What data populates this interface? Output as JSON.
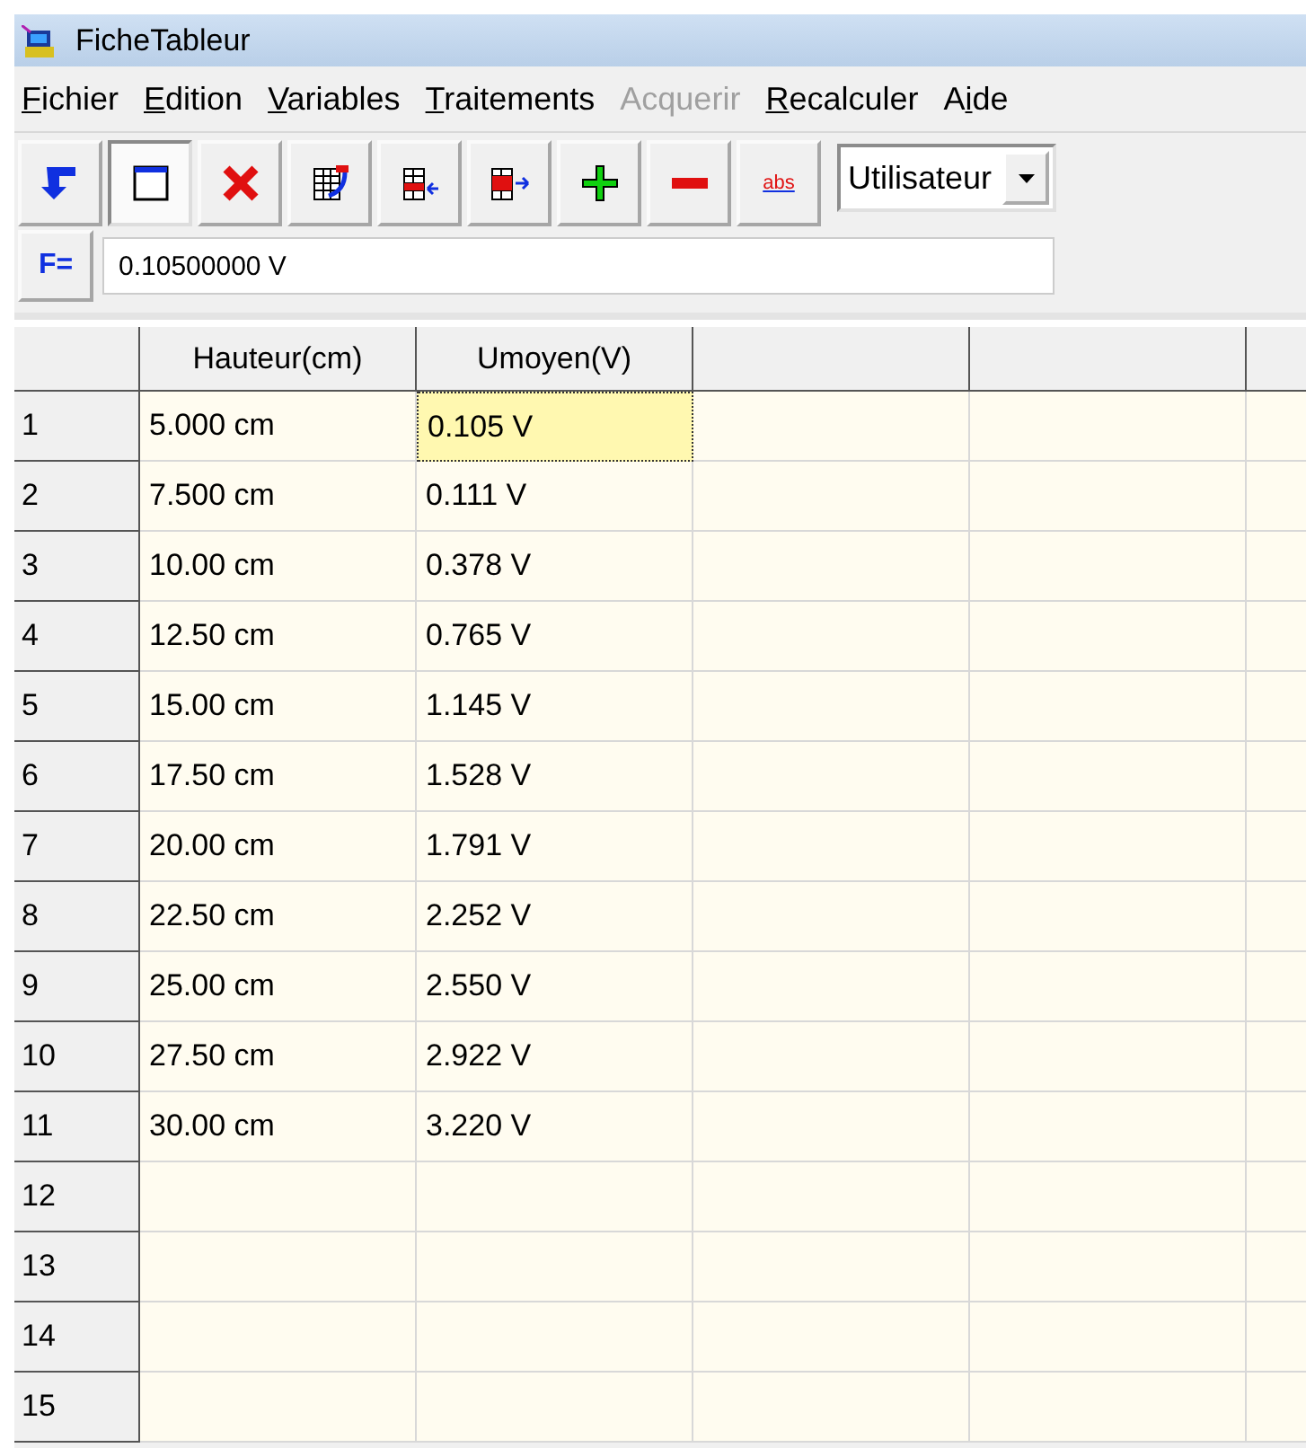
{
  "window": {
    "title": "FicheTableur"
  },
  "menu": [
    {
      "key": "F",
      "post": "ichier",
      "disabled": false
    },
    {
      "key": "E",
      "post": "dition",
      "disabled": false
    },
    {
      "key": "V",
      "post": "ariables",
      "disabled": false
    },
    {
      "key": "T",
      "post": "raitements",
      "disabled": false
    },
    {
      "pre": "Acquerir",
      "disabled": true
    },
    {
      "key": "R",
      "post": "ecalculer",
      "disabled": false
    },
    {
      "pre": "A",
      "key": "i",
      "post": "de",
      "disabled": false
    }
  ],
  "toolbar": [
    {
      "kind": "arrow",
      "selected": false
    },
    {
      "kind": "window",
      "selected": true
    },
    {
      "kind": "delete",
      "selected": false
    },
    {
      "kind": "edit-grid",
      "selected": false
    },
    {
      "kind": "grid-left",
      "selected": false
    },
    {
      "kind": "grid-right",
      "selected": false
    },
    {
      "kind": "plus",
      "selected": false
    },
    {
      "kind": "minus",
      "selected": false
    },
    {
      "kind": "text",
      "label": "abs",
      "selected": false
    }
  ],
  "mode_dropdown": {
    "value": "Utilisateur"
  },
  "formula": {
    "label": "F=",
    "value": "0.10500000 V"
  },
  "table": {
    "columns": [
      "Hauteur(cm)",
      "Umoyen(V)"
    ],
    "rows": [
      {
        "number": "1",
        "cells": [
          {
            "text": "5.000 cm",
            "selected": false
          },
          {
            "text": "0.105 V",
            "selected": true
          }
        ]
      },
      {
        "number": "2",
        "cells": [
          {
            "text": "7.500 cm",
            "selected": false
          },
          {
            "text": "0.111 V",
            "selected": false
          }
        ]
      },
      {
        "number": "3",
        "cells": [
          {
            "text": "10.00 cm",
            "selected": false
          },
          {
            "text": "0.378 V",
            "selected": false
          }
        ]
      },
      {
        "number": "4",
        "cells": [
          {
            "text": "12.50 cm",
            "selected": false
          },
          {
            "text": "0.765 V",
            "selected": false
          }
        ]
      },
      {
        "number": "5",
        "cells": [
          {
            "text": "15.00 cm",
            "selected": false
          },
          {
            "text": "1.145 V",
            "selected": false
          }
        ]
      },
      {
        "number": "6",
        "cells": [
          {
            "text": "17.50 cm",
            "selected": false
          },
          {
            "text": "1.528 V",
            "selected": false
          }
        ]
      },
      {
        "number": "7",
        "cells": [
          {
            "text": "20.00 cm",
            "selected": false
          },
          {
            "text": "1.791 V",
            "selected": false
          }
        ]
      },
      {
        "number": "8",
        "cells": [
          {
            "text": "22.50 cm",
            "selected": false
          },
          {
            "text": "2.252 V",
            "selected": false
          }
        ]
      },
      {
        "number": "9",
        "cells": [
          {
            "text": "25.00 cm",
            "selected": false
          },
          {
            "text": "2.550 V",
            "selected": false
          }
        ]
      },
      {
        "number": "10",
        "cells": [
          {
            "text": "27.50 cm",
            "selected": false
          },
          {
            "text": "2.922 V",
            "selected": false
          }
        ]
      },
      {
        "number": "11",
        "cells": [
          {
            "text": "30.00 cm",
            "selected": false
          },
          {
            "text": "3.220 V",
            "selected": false
          }
        ]
      },
      {
        "number": "12",
        "cells": []
      },
      {
        "number": "13",
        "cells": []
      },
      {
        "number": "14",
        "cells": []
      },
      {
        "number": "15",
        "cells": []
      }
    ]
  }
}
